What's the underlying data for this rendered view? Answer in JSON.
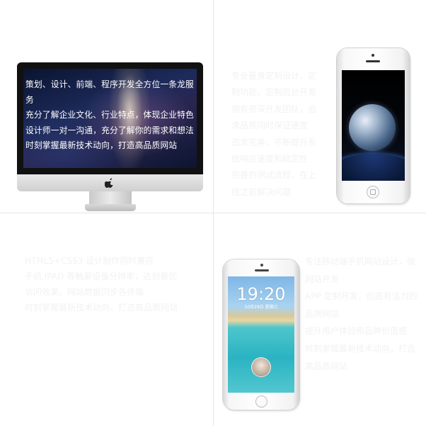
{
  "imac_panel": {
    "lines": [
      "策划、设计、前端、程序开发全方位一条龙服务",
      "充分了解企业文化、行业特点，体现企业特色",
      "设计师一对一沟通，充分了解你的需求和想法",
      "时刻掌握最新技术动向，打造高品质网站"
    ]
  },
  "custom_panel": {
    "lines": [
      "专业量身定制设计，定制功能，定制后台开发",
      "拥有资深开发团队，追求品质同时保证速度",
      "追求完美，不断提升系统响应速度和稳定性",
      "完善的测试流程，在上线之前解决问题"
    ]
  },
  "html5_panel": {
    "lines": [
      "HTML5+CSS3 设计制作同时兼容",
      "手机,IPAD 等触屏设备分辨率，达到最优",
      "访问效果，网站数据同步各终端",
      "时刻掌握最新技术动向，打造高品质网站"
    ]
  },
  "mobile_panel": {
    "lines": [
      "专注移动端手机网站设计，微网站开发",
      "APP 定制开发，创造有活力的品牌网站",
      "提升用户体验和品牌价值感",
      "时刻掌握最新技术动向，打造高品质网站"
    ]
  },
  "lockscreen": {
    "time": "19:20",
    "date": "10月29日 星期三"
  },
  "colors": {
    "faint_text": "#f2f2f2",
    "divider": "#e6e6e6",
    "imac_text": "#ffffff"
  },
  "icons": [
    "apple-logo-icon",
    "iphone-home-button-icon"
  ]
}
